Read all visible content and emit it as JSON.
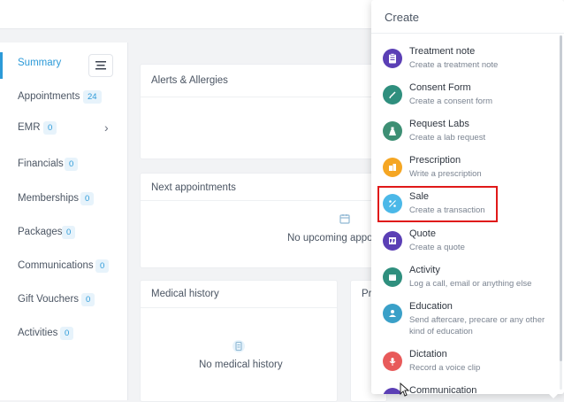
{
  "sidebar": {
    "items": [
      {
        "label": "Summary",
        "badge": null
      },
      {
        "label": "Appointments",
        "badge": "24"
      },
      {
        "label": "EMR",
        "badge": "0"
      },
      {
        "label": "Financials",
        "badge": "0"
      },
      {
        "label": "Memberships",
        "badge": "0"
      },
      {
        "label": "Packages",
        "badge": "0"
      },
      {
        "label": "Communications",
        "badge": "0"
      },
      {
        "label": "Gift Vouchers",
        "badge": "0"
      },
      {
        "label": "Activities",
        "badge": "0"
      }
    ]
  },
  "cards": {
    "alerts": {
      "title": "Alerts & Allergies"
    },
    "next_appointments": {
      "title": "Next appointments",
      "empty": "No upcoming appoi"
    },
    "medical_history": {
      "title": "Medical history",
      "empty": "No medical history"
    },
    "partial": {
      "title": "Pr"
    }
  },
  "create_menu": {
    "header": "Create",
    "items": [
      {
        "title": "Treatment note",
        "desc": "Create a treatment note",
        "icon": "clipboard-icon",
        "color": "#5b3fb5"
      },
      {
        "title": "Consent Form",
        "desc": "Create a consent form",
        "icon": "pen-icon",
        "color": "#2f8f7e"
      },
      {
        "title": "Request Labs",
        "desc": "Create a lab request",
        "icon": "flask-icon",
        "color": "#3d8f74"
      },
      {
        "title": "Prescription",
        "desc": "Write a prescription",
        "icon": "prescription-icon",
        "color": "#f5a623"
      },
      {
        "title": "Sale",
        "desc": "Create a transaction",
        "icon": "percent-icon",
        "color": "#4bb8e8"
      },
      {
        "title": "Quote",
        "desc": "Create a quote",
        "icon": "quote-icon",
        "color": "#5b3fb5"
      },
      {
        "title": "Activity",
        "desc": "Log a call, email or anything else",
        "icon": "calendar-icon",
        "color": "#2f8f7e"
      },
      {
        "title": "Education",
        "desc": "Send aftercare, precare or any other kind of education",
        "icon": "user-icon",
        "color": "#3aa0c8"
      },
      {
        "title": "Dictation",
        "desc": "Record a voice clip",
        "icon": "mic-icon",
        "color": "#e85a5a"
      },
      {
        "title": "Communication",
        "desc": "",
        "icon": "chat-icon",
        "color": "#5b3fb5"
      }
    ]
  }
}
